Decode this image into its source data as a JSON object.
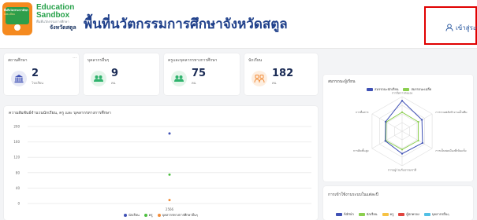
{
  "header": {
    "logo": {
      "badge_line1": "พื้นที่นวัตกรรมการศึกษา",
      "badge_line2": "ลงทะเบียน",
      "title_line1": "Education",
      "title_line2": "Sandbox",
      "subtitle": "พื้นที่นวัตกรรมการศึกษา",
      "province": "จังหวัดสตูล"
    },
    "page_title": "พื้นที่นวัตกรรมการศึกษาจังหวัดสตูล",
    "login_label": "เข้าสู่ระบบ",
    "login_icon": "user-icon"
  },
  "stats": [
    {
      "title": "สถานศึกษา",
      "value": "2",
      "unit": "โรงเรียน",
      "icon": "school-icon",
      "color": "#3f51b5",
      "bg": "#e8eaf6"
    },
    {
      "title": "บุคลากรอื่นๆ",
      "value": "9",
      "unit": "คน",
      "icon": "users-icon",
      "color": "#2fb36d",
      "bg": "#e4f5ea"
    },
    {
      "title": "ครูและบุคลากรทางการศึกษา",
      "value": "75",
      "unit": "คน",
      "icon": "users-icon",
      "color": "#2fb36d",
      "bg": "#e4f5ea"
    },
    {
      "title": "นักเรียน",
      "value": "182",
      "unit": "คน",
      "icon": "students-icon",
      "color": "#f28c38",
      "bg": "#fdeee0"
    }
  ],
  "stats_menu_icon": "more-icon",
  "bar_panel": {
    "title": "ความสัมพันธ์จำนวนนักเรียน, ครู และ บุคลากรทางการศึกษา"
  },
  "radar_panel": {
    "title": "สมรรถนะผู้เรียน",
    "axes": [
      "การจัดการตนเอง",
      "การรวมพลังทำงานเป็นทีม",
      "การเป็นพลเมืองที่เข้มแข็ง",
      "การอยู่ร่วมกับธรรมชาติ",
      "การคิดขั้นสูง",
      "การสื่อสาร"
    ]
  },
  "usage_panel": {
    "title": "การเข้าใช้งานระบบในแต่ละปี",
    "legend": [
      "Admin",
      "นักเรียน",
      "ครู",
      "ผู้ปกครอง",
      "บุคลากรอื่นๆ"
    ]
  },
  "colors": {
    "accent": "#1e3f8a",
    "student": "#3f51b5",
    "teacher": "#4cbf3f",
    "staff": "#f28c38",
    "baseline": "#3d6ad6",
    "radar_green": "#8bcf4f",
    "usage": [
      "#3f51b5",
      "#8bcf4f",
      "#f6c244",
      "#e0443e",
      "#52c0e5"
    ]
  },
  "chart_data": [
    {
      "type": "scatter",
      "title": "ความสัมพันธ์จำนวนนักเรียน, ครู และ บุคลากรทางการศึกษา",
      "xlabel": "",
      "ylabel": "",
      "x": [
        "2566"
      ],
      "ylim": [
        0,
        200
      ],
      "yticks": [
        0,
        40,
        80,
        120,
        160,
        200
      ],
      "series": [
        {
          "name": "นักเรียน",
          "values": [
            182
          ],
          "color": "#3f51b5"
        },
        {
          "name": "ครู",
          "values": [
            75
          ],
          "color": "#4cbf3f"
        },
        {
          "name": "บุคลากรทางการศึกษาอื่นๆ",
          "values": [
            9
          ],
          "color": "#f28c38"
        }
      ],
      "legend": "bottom",
      "grid": true
    },
    {
      "type": "radar",
      "title": "สมรรถนะผู้เรียน",
      "categories": [
        "การจัดการตนเอง",
        "การรวมพลังทำงานเป็นทีม",
        "การเป็นพลเมืองที่เข้มแข็ง",
        "การอยู่ร่วมกับธรรมชาติ",
        "การคิดขั้นสูง",
        "การสื่อสาร"
      ],
      "series": [
        {
          "name": "สมรรถนะนักเรียน",
          "values": [
            0.88,
            0.66,
            0.68,
            0.65,
            0.56,
            0.55
          ],
          "color": "#3f51b5"
        },
        {
          "name": "สมรรถนะเฉลี่ย",
          "values": [
            0.55,
            0.54,
            0.54,
            0.53,
            0.54,
            0.53
          ],
          "color": "#8bcf4f"
        }
      ],
      "legend": "top",
      "grid": true
    }
  ]
}
